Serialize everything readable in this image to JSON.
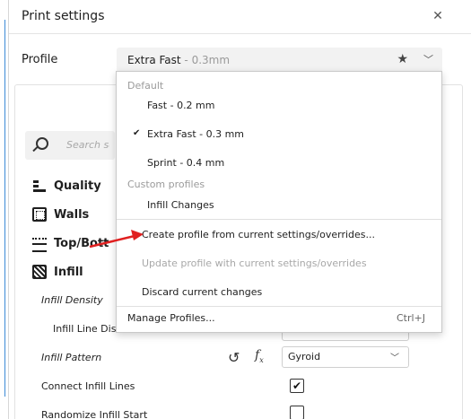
{
  "window": {
    "title": "Print settings"
  },
  "profile": {
    "label": "Profile",
    "selected_name": "Extra Fast",
    "selected_suffix": " - 0.3mm"
  },
  "search": {
    "placeholder": "Search se"
  },
  "categories": [
    {
      "label": "Quality",
      "icon": "quality-icon"
    },
    {
      "label": "Walls",
      "icon": "walls-icon"
    },
    {
      "label": "Top/Botto",
      "icon": "top-bottom-icon"
    },
    {
      "label": "Infill",
      "icon": "infill-icon"
    }
  ],
  "settings": {
    "infill_density": "Infill Density",
    "infill_line_distance": "Infill Line Dist",
    "infill_pattern": "Infill Pattern",
    "infill_pattern_value": "Gyroid",
    "connect_infill_lines": "Connect Infill Lines",
    "connect_infill_lines_checked": "✔",
    "randomize_infill_start": "Randomize Infill Start"
  },
  "menu": {
    "default_header": "Default",
    "items_default": [
      "Fast - 0.2 mm",
      "Extra Fast - 0.3 mm",
      "Sprint - 0.4 mm"
    ],
    "checked_mark": "✔",
    "custom_header": "Custom profiles",
    "items_custom": [
      "Infill Changes"
    ],
    "create": "Create profile from current settings/overrides...",
    "update": "Update profile with current settings/overrides",
    "discard": "Discard current changes",
    "manage": "Manage Profiles...",
    "manage_shortcut": "Ctrl+J"
  },
  "colors": {
    "arrow": "#e02020",
    "accent_line": "#3d8bd6"
  },
  "icons": {
    "close": "close-icon",
    "favorite": "star-icon",
    "dropdown": "chevron-down-icon",
    "reset": "reset-icon",
    "formula": "fx-icon",
    "check": "check-icon",
    "search": "search-icon"
  }
}
